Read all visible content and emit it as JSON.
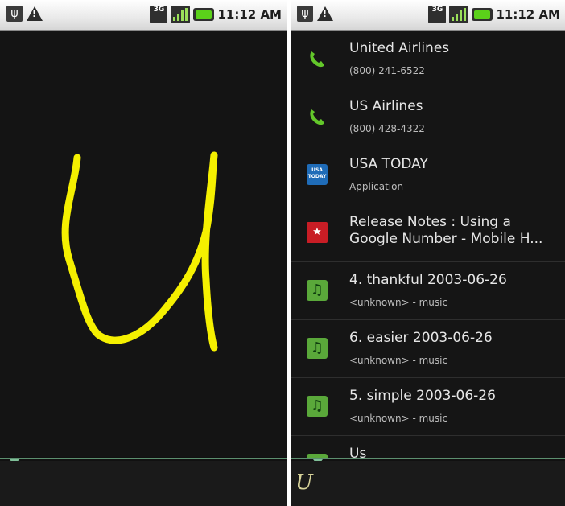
{
  "status_bar": {
    "time": "11:12 AM",
    "network": "3G",
    "icons": [
      "usb-icon",
      "warning-icon",
      "network-3g-icon",
      "signal-icon",
      "battery-icon"
    ]
  },
  "gesture": {
    "drawn_letter": "U",
    "stroke_color": "#f5f000"
  },
  "search": {
    "query": "U"
  },
  "results": [
    {
      "icon": "phone-icon",
      "title": "United Airlines",
      "subtitle": "(800) 241-6522"
    },
    {
      "icon": "phone-icon",
      "title": "US Airlines",
      "subtitle": "(800) 428-4322"
    },
    {
      "icon": "usa-today-app-icon",
      "title": "USA TODAY",
      "subtitle": "Application"
    },
    {
      "icon": "bookmark-icon",
      "title": "Release Notes : Using a Google Number - Mobile H...",
      "subtitle": ""
    },
    {
      "icon": "music-icon",
      "title": "4. thankful 2003-06-26",
      "subtitle": "<unknown> - music"
    },
    {
      "icon": "music-icon",
      "title": "6. easier 2003-06-26",
      "subtitle": "<unknown> - music"
    },
    {
      "icon": "music-icon",
      "title": "5. simple 2003-06-26",
      "subtitle": "<unknown> - music"
    },
    {
      "icon": "music-icon",
      "title": "Us",
      "subtitle": ""
    }
  ],
  "colors": {
    "accent_green": "#5bd11a",
    "divider": "#5c8f6f",
    "background": "#141414"
  }
}
